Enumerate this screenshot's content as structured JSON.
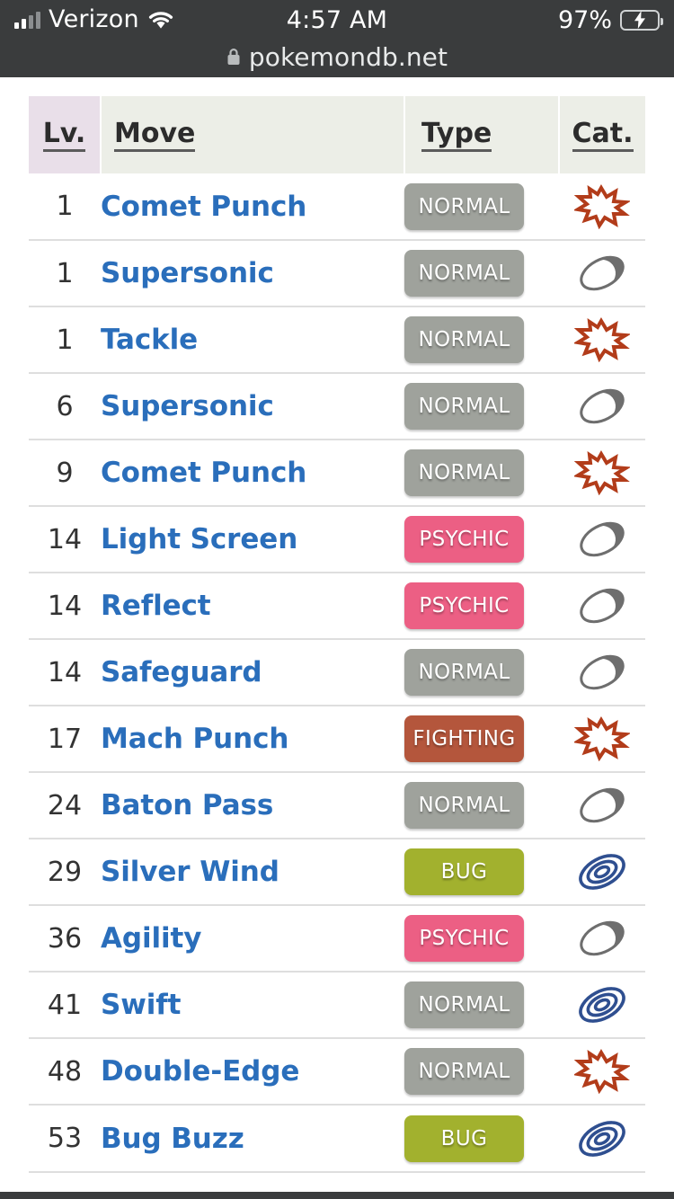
{
  "status_bar": {
    "carrier": "Verizon",
    "signal_icon": "cellular-signal-icon",
    "wifi_icon": "wifi-icon",
    "time": "4:57 AM",
    "battery_percent": "97%",
    "battery_icon": "battery-charging-icon",
    "battery_color": "#3ad352"
  },
  "browser": {
    "lock_icon": "lock-icon",
    "url": "pokemondb.net"
  },
  "table": {
    "name": "moves-learned-by-level-table",
    "headers": {
      "level": "Lv.",
      "move": "Move",
      "type": "Type",
      "category": "Cat."
    },
    "header_bg_level": "#e9dfe9",
    "header_bg": "#eceee7",
    "link_color": "#2a6ebb",
    "rows": [
      {
        "level": "1",
        "move": "Comet Punch",
        "type": "NORMAL",
        "type_color": "#9fa29c",
        "cat": "physical"
      },
      {
        "level": "1",
        "move": "Supersonic",
        "type": "NORMAL",
        "type_color": "#9fa29c",
        "cat": "status"
      },
      {
        "level": "1",
        "move": "Tackle",
        "type": "NORMAL",
        "type_color": "#9fa29c",
        "cat": "physical"
      },
      {
        "level": "6",
        "move": "Supersonic",
        "type": "NORMAL",
        "type_color": "#9fa29c",
        "cat": "status"
      },
      {
        "level": "9",
        "move": "Comet Punch",
        "type": "NORMAL",
        "type_color": "#9fa29c",
        "cat": "physical"
      },
      {
        "level": "14",
        "move": "Light Screen",
        "type": "PSYCHIC",
        "type_color": "#ec5f84",
        "cat": "status"
      },
      {
        "level": "14",
        "move": "Reflect",
        "type": "PSYCHIC",
        "type_color": "#ec5f84",
        "cat": "status"
      },
      {
        "level": "14",
        "move": "Safeguard",
        "type": "NORMAL",
        "type_color": "#9fa29c",
        "cat": "status"
      },
      {
        "level": "17",
        "move": "Mach Punch",
        "type": "FIGHTING",
        "type_color": "#b4563c",
        "cat": "physical"
      },
      {
        "level": "24",
        "move": "Baton Pass",
        "type": "NORMAL",
        "type_color": "#9fa29c",
        "cat": "status"
      },
      {
        "level": "29",
        "move": "Silver Wind",
        "type": "BUG",
        "type_color": "#a2b12e",
        "cat": "special"
      },
      {
        "level": "36",
        "move": "Agility",
        "type": "PSYCHIC",
        "type_color": "#ec5f84",
        "cat": "status"
      },
      {
        "level": "41",
        "move": "Swift",
        "type": "NORMAL",
        "type_color": "#9fa29c",
        "cat": "special"
      },
      {
        "level": "48",
        "move": "Double-Edge",
        "type": "NORMAL",
        "type_color": "#9fa29c",
        "cat": "physical"
      },
      {
        "level": "53",
        "move": "Bug Buzz",
        "type": "BUG",
        "type_color": "#a2b12e",
        "cat": "special"
      }
    ],
    "category_icons": {
      "physical": "physical-burst-icon",
      "special": "special-spiral-icon",
      "status": "status-halfcircle-icon"
    },
    "category_colors": {
      "physical": "#b23c1a",
      "special": "#2f4f90",
      "status": "#6e6e6e"
    }
  }
}
